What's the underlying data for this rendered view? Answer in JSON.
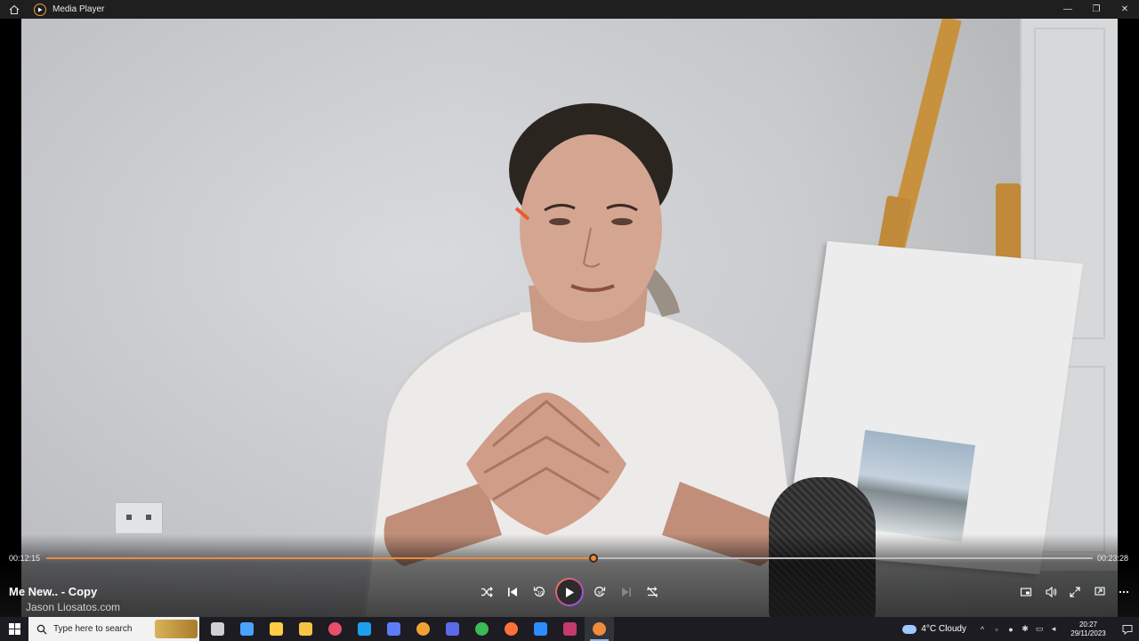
{
  "window": {
    "title": "Media Player",
    "minimize": "—",
    "restore": "❐",
    "close": "✕"
  },
  "playback": {
    "current_time": "00:12:15",
    "duration": "00:23:28",
    "progress_fraction": 0.5227
  },
  "now_playing": {
    "title": "Me New.. - Copy",
    "watermark": "Jason Liosatos.com"
  },
  "colors": {
    "accent": "#f08a3c",
    "titlebar": "#1f1f1f",
    "taskbar": "#1c1c22"
  },
  "controls": [
    "shuffle-icon",
    "previous-icon",
    "rewind-10-icon",
    "play-icon",
    "forward-30-icon",
    "next-icon",
    "repeat-off-icon"
  ],
  "right_controls": [
    "miniplayer-icon",
    "volume-icon",
    "fullscreen-icon",
    "cast-icon",
    "more-icon"
  ],
  "taskbar": {
    "search_placeholder": "Type here to search",
    "weather_temp": "4°C",
    "weather_text": "Cloudy",
    "clock_time": "20:27",
    "clock_date": "29/11/2023",
    "apps": [
      {
        "name": "task-view-icon",
        "color": "#d0d0d0"
      },
      {
        "name": "widgets-icon",
        "color": "#4aa3ff"
      },
      {
        "name": "store-icon",
        "color": "#ffcc44"
      },
      {
        "name": "file-explorer-icon",
        "color": "#f5c542"
      },
      {
        "name": "app-colorful-icon",
        "color": "#e94f6b"
      },
      {
        "name": "skype-icon",
        "color": "#1ea0f0"
      },
      {
        "name": "visual-studio-icon",
        "color": "#5c7cfa"
      },
      {
        "name": "chrome-canary-icon",
        "color": "#f2a233"
      },
      {
        "name": "power-automate-icon",
        "color": "#5b6ae8"
      },
      {
        "name": "chrome-icon",
        "color": "#3cba54"
      },
      {
        "name": "firefox-icon",
        "color": "#ff7139"
      },
      {
        "name": "zoom-icon",
        "color": "#2d8cff"
      },
      {
        "name": "vectorworks-icon",
        "color": "#c43a6a"
      },
      {
        "name": "media-player-icon",
        "color": "#f08a3c",
        "active": true
      }
    ]
  }
}
